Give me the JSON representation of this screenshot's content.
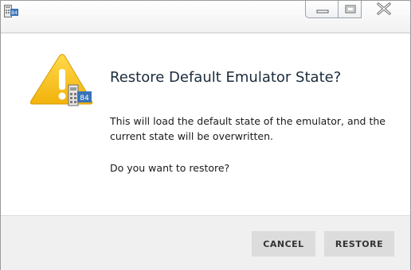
{
  "window": {
    "icon": "emulator-84-icon",
    "controls": {
      "minimize_icon": "minimize-icon",
      "maximize_icon": "maximize-icon",
      "close_icon": "close-icon"
    }
  },
  "dialog": {
    "icon": "warning-icon",
    "badge_text": "84",
    "heading": "Restore Default Emulator State?",
    "message": "This will load the default state of the emulator, and the current state will be overwritten.",
    "question": "Do you want to restore?"
  },
  "buttons": {
    "cancel_label": "CANCEL",
    "restore_label": "RESTORE"
  },
  "colors": {
    "warning_yellow": "#f6c21c",
    "badge_blue": "#3a73b8",
    "footer_bg": "#f0f0f0",
    "button_bg": "#dcdcdc"
  }
}
